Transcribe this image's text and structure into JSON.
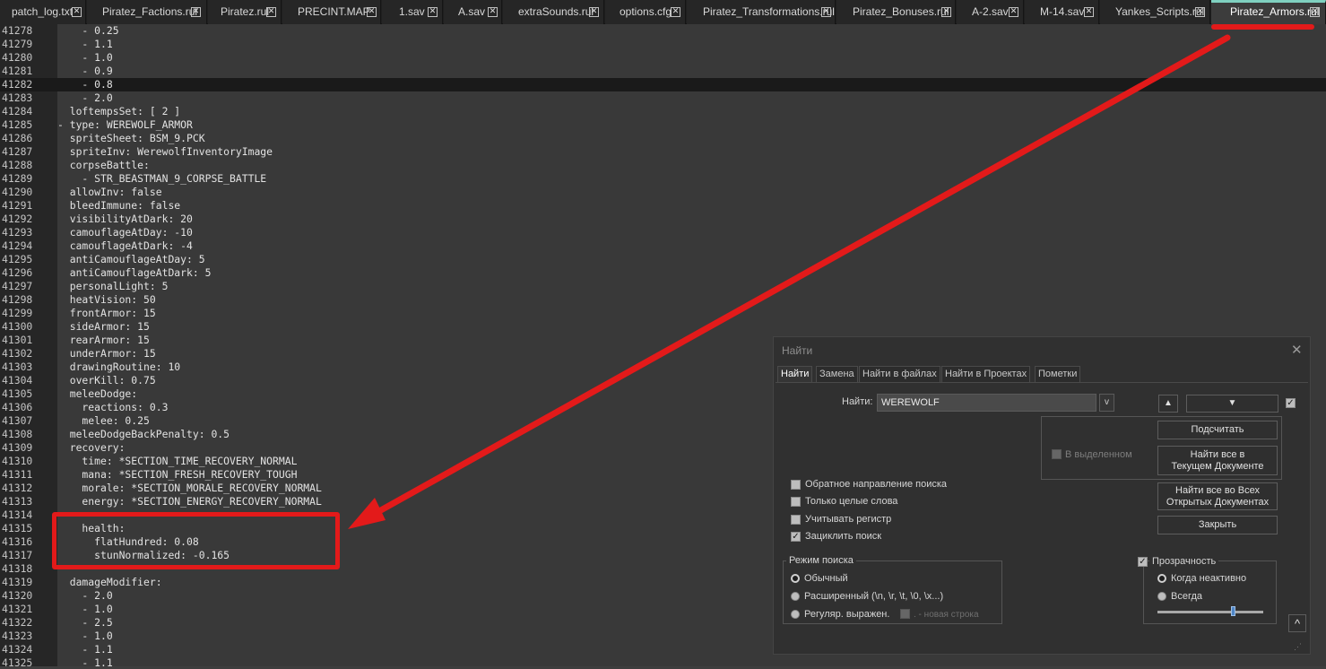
{
  "tabs": [
    {
      "label": "patch_log.txt",
      "active": false
    },
    {
      "label": "Piratez_Factions.rul",
      "active": false
    },
    {
      "label": "Piratez.rul",
      "active": false
    },
    {
      "label": "PRECINT.MAP",
      "active": false
    },
    {
      "label": "1.sav",
      "active": false
    },
    {
      "label": "A.sav",
      "active": false
    },
    {
      "label": "extraSounds.rul",
      "active": false
    },
    {
      "label": "options.cfg",
      "active": false
    },
    {
      "label": "Piratez_Transformations.rul",
      "active": false
    },
    {
      "label": "Piratez_Bonuses.rul",
      "active": false
    },
    {
      "label": "A-2.sav",
      "active": false
    },
    {
      "label": "M-14.sav",
      "active": false
    },
    {
      "label": "Yankes_Scripts.rul",
      "active": false
    },
    {
      "label": "Piratez_Armors.rul",
      "active": true
    }
  ],
  "tab_close_glyph": "✕",
  "editor": {
    "current_line": "41282",
    "lines": [
      {
        "n": "41278",
        "text": "    - 0.25"
      },
      {
        "n": "41279",
        "text": "    - 1.1"
      },
      {
        "n": "41280",
        "text": "    - 1.0"
      },
      {
        "n": "41281",
        "text": "    - 0.9"
      },
      {
        "n": "41282",
        "text": "    - 0.8"
      },
      {
        "n": "41283",
        "text": "    - 2.0"
      },
      {
        "n": "41284",
        "text": "  loftempsSet: [ 2 ]"
      },
      {
        "n": "41285",
        "text": "- type: WEREWOLF_ARMOR"
      },
      {
        "n": "41286",
        "text": "  spriteSheet: BSM_9.PCK"
      },
      {
        "n": "41287",
        "text": "  spriteInv: WerewolfInventoryImage"
      },
      {
        "n": "41288",
        "text": "  corpseBattle:"
      },
      {
        "n": "41289",
        "text": "    - STR_BEASTMAN_9_CORPSE_BATTLE"
      },
      {
        "n": "41290",
        "text": "  allowInv: false"
      },
      {
        "n": "41291",
        "text": "  bleedImmune: false"
      },
      {
        "n": "41292",
        "text": "  visibilityAtDark: 20"
      },
      {
        "n": "41293",
        "text": "  camouflageAtDay: -10"
      },
      {
        "n": "41294",
        "text": "  camouflageAtDark: -4"
      },
      {
        "n": "41295",
        "text": "  antiCamouflageAtDay: 5"
      },
      {
        "n": "41296",
        "text": "  antiCamouflageAtDark: 5"
      },
      {
        "n": "41297",
        "text": "  personalLight: 5"
      },
      {
        "n": "41298",
        "text": "  heatVision: 50"
      },
      {
        "n": "41299",
        "text": "  frontArmor: 15"
      },
      {
        "n": "41300",
        "text": "  sideArmor: 15"
      },
      {
        "n": "41301",
        "text": "  rearArmor: 15"
      },
      {
        "n": "41302",
        "text": "  underArmor: 15"
      },
      {
        "n": "41303",
        "text": "  drawingRoutine: 10"
      },
      {
        "n": "41304",
        "text": "  overKill: 0.75"
      },
      {
        "n": "41305",
        "text": "  meleeDodge:"
      },
      {
        "n": "41306",
        "text": "    reactions: 0.3"
      },
      {
        "n": "41307",
        "text": "    melee: 0.25"
      },
      {
        "n": "41308",
        "text": "  meleeDodgeBackPenalty: 0.5"
      },
      {
        "n": "41309",
        "text": "  recovery:"
      },
      {
        "n": "41310",
        "text": "    time: *SECTION_TIME_RECOVERY_NORMAL"
      },
      {
        "n": "41311",
        "text": "    mana: *SECTION_FRESH_RECOVERY_TOUGH"
      },
      {
        "n": "41312",
        "text": "    morale: *SECTION_MORALE_RECOVERY_NORMAL"
      },
      {
        "n": "41313",
        "text": "    energy: *SECTION_ENERGY_RECOVERY_NORMAL"
      },
      {
        "n": "41314",
        "text": ""
      },
      {
        "n": "41315",
        "text": "    health:"
      },
      {
        "n": "41316",
        "text": "      flatHundred: 0.08"
      },
      {
        "n": "41317",
        "text": "      stunNormalized: -0.165"
      },
      {
        "n": "41318",
        "text": ""
      },
      {
        "n": "41319",
        "text": "  damageModifier:"
      },
      {
        "n": "41320",
        "text": "    - 2.0"
      },
      {
        "n": "41321",
        "text": "    - 1.0"
      },
      {
        "n": "41322",
        "text": "    - 2.5"
      },
      {
        "n": "41323",
        "text": "    - 1.0"
      },
      {
        "n": "41324",
        "text": "    - 1.1"
      },
      {
        "n": "41325",
        "text": "    - 1.1"
      }
    ]
  },
  "find_dialog": {
    "title": "Найти",
    "close_glyph": "✕",
    "tabs": [
      "Найти",
      "Замена",
      "Найти в файлах",
      "Найти в Проектах",
      "Пометки"
    ],
    "find_label": "Найти:",
    "find_value": "WEREWOLF",
    "dropdown_glyph": "v",
    "up_glyph": "▲",
    "down_glyph": "▼",
    "in_selection_label": "В выделенном",
    "count_button": "Подсчитать",
    "find_all_current_line1": "Найти все в",
    "find_all_current_line2": "Текущем Документе",
    "find_all_open_line1": "Найти все во Всех",
    "find_all_open_line2": "Открытых Документах",
    "close_button": "Закрыть",
    "options": [
      {
        "label": "Обратное направление поиска",
        "checked": false
      },
      {
        "label": "Только целые слова",
        "checked": false
      },
      {
        "label": "Учитывать регистр",
        "checked": false
      },
      {
        "label": "Зациклить поиск",
        "checked": true
      }
    ],
    "search_mode": {
      "title": "Режим поиска",
      "normal": "Обычный",
      "extended": "Расширенный (\\n, \\r, \\t, \\0, \\x...)",
      "regex": "Регуляр. выражен.",
      "newline_hint": ". - новая строка",
      "selected": "normal"
    },
    "transparency": {
      "title": "Прозрачность",
      "enabled": true,
      "on_lose_focus": "Когда неактивно",
      "always": "Всегда",
      "selected": "on_lose_focus",
      "level": 0.7
    },
    "collapse_glyph": "^",
    "check_glyph": "✓"
  },
  "colors": {
    "annotation_red": "#e31a1a",
    "active_tab_accent": "#7fd0c0"
  }
}
